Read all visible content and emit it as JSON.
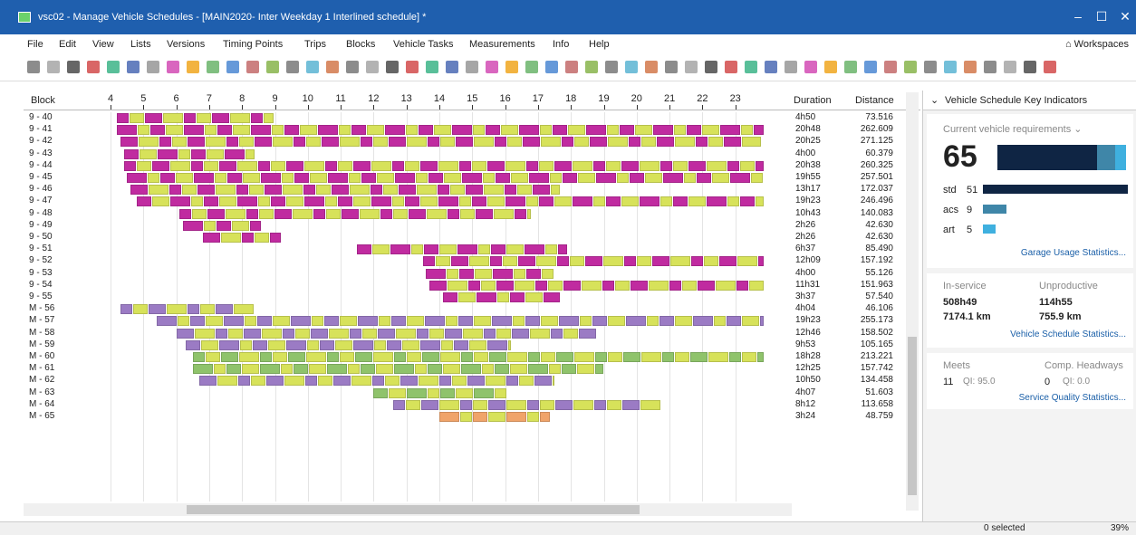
{
  "window": {
    "title": "vsc02 - Manage Vehicle Schedules - [MAIN2020- Inter Weekday 1 Interlined schedule] *"
  },
  "menu": [
    "File",
    "Edit",
    "View",
    "Lists",
    "Versions",
    "Timing Points",
    "Trips",
    "Blocks",
    "Vehicle Tasks",
    "Measurements",
    "Info",
    "Help"
  ],
  "workspaces_label": "Workspaces",
  "grid": {
    "block_header": "Block",
    "duration_header": "Duration",
    "distance_header": "Distance",
    "hours": [
      "4",
      "5",
      "6",
      "7",
      "8",
      "9",
      "10",
      "11",
      "12",
      "13",
      "14",
      "15",
      "16",
      "17",
      "18",
      "19",
      "20",
      "21",
      "22",
      "23"
    ],
    "rows": [
      {
        "block": "9 - 40",
        "duration": "4h50",
        "distance": "73.516",
        "start": 4.2,
        "end": 9.0,
        "color": "magenta"
      },
      {
        "block": "9 - 41",
        "duration": "20h48",
        "distance": "262.609",
        "start": 4.2,
        "end": 23.9,
        "color": "magenta"
      },
      {
        "block": "9 - 42",
        "duration": "20h25",
        "distance": "271.125",
        "start": 4.3,
        "end": 23.8,
        "color": "magenta"
      },
      {
        "block": "9 - 43",
        "duration": "4h00",
        "distance": "60.379",
        "start": 4.4,
        "end": 8.4,
        "color": "magenta"
      },
      {
        "block": "9 - 44",
        "duration": "20h38",
        "distance": "260.325",
        "start": 4.4,
        "end": 23.9,
        "color": "magenta"
      },
      {
        "block": "9 - 45",
        "duration": "19h55",
        "distance": "257.501",
        "start": 4.5,
        "end": 23.9,
        "color": "magenta"
      },
      {
        "block": "9 - 46",
        "duration": "13h17",
        "distance": "172.037",
        "start": 4.6,
        "end": 17.7,
        "color": "magenta"
      },
      {
        "block": "9 - 47",
        "duration": "19h23",
        "distance": "246.496",
        "start": 4.8,
        "end": 23.9,
        "color": "magenta"
      },
      {
        "block": "9 - 48",
        "duration": "10h43",
        "distance": "140.083",
        "start": 6.1,
        "end": 16.8,
        "color": "magenta"
      },
      {
        "block": "9 - 49",
        "duration": "2h26",
        "distance": "42.630",
        "start": 6.2,
        "end": 8.6,
        "color": "magenta"
      },
      {
        "block": "9 - 50",
        "duration": "2h26",
        "distance": "42.630",
        "start": 6.8,
        "end": 9.2,
        "color": "magenta"
      },
      {
        "block": "9 - 51",
        "duration": "6h37",
        "distance": "85.490",
        "start": 11.5,
        "end": 17.9,
        "color": "magenta"
      },
      {
        "block": "9 - 52",
        "duration": "12h09",
        "distance": "157.192",
        "start": 13.5,
        "end": 23.9,
        "color": "magenta"
      },
      {
        "block": "9 - 53",
        "duration": "4h00",
        "distance": "55.126",
        "start": 13.6,
        "end": 17.5,
        "color": "magenta"
      },
      {
        "block": "9 - 54",
        "duration": "11h31",
        "distance": "151.963",
        "start": 13.7,
        "end": 23.9,
        "color": "magenta"
      },
      {
        "block": "9 - 55",
        "duration": "3h37",
        "distance": "57.540",
        "start": 14.1,
        "end": 17.7,
        "color": "magenta"
      },
      {
        "block": "M - 56",
        "duration": "4h04",
        "distance": "46.106",
        "start": 4.3,
        "end": 8.4,
        "color": "purple"
      },
      {
        "block": "M - 57",
        "duration": "19h23",
        "distance": "255.173",
        "start": 5.4,
        "end": 23.9,
        "color": "purple"
      },
      {
        "block": "M - 58",
        "duration": "12h46",
        "distance": "158.502",
        "start": 6.0,
        "end": 18.8,
        "color": "purple"
      },
      {
        "block": "M - 59",
        "duration": "9h53",
        "distance": "105.165",
        "start": 6.3,
        "end": 16.2,
        "color": "purple"
      },
      {
        "block": "M - 60",
        "duration": "18h28",
        "distance": "213.221",
        "start": 6.5,
        "end": 23.9,
        "color": "green"
      },
      {
        "block": "M - 61",
        "duration": "12h25",
        "distance": "157.742",
        "start": 6.5,
        "end": 19.0,
        "color": "green"
      },
      {
        "block": "M - 62",
        "duration": "10h50",
        "distance": "134.458",
        "start": 6.7,
        "end": 17.5,
        "color": "purple"
      },
      {
        "block": "M - 63",
        "duration": "4h07",
        "distance": "51.603",
        "start": 12.0,
        "end": 16.1,
        "color": "green"
      },
      {
        "block": "M - 64",
        "duration": "8h12",
        "distance": "113.658",
        "start": 12.6,
        "end": 20.8,
        "color": "purple"
      },
      {
        "block": "M - 65",
        "duration": "3h24",
        "distance": "48.759",
        "start": 14.0,
        "end": 17.4,
        "color": "orange"
      }
    ]
  },
  "panel": {
    "title": "Vehicle Schedule Key Indicators",
    "current_req_label": "Current vehicle requirements",
    "total": "65",
    "std_label": "std",
    "std_value": "51",
    "acs_label": "acs",
    "acs_value": "9",
    "art_label": "art",
    "art_value": "5",
    "garage_link": "Garage Usage Statistics...",
    "inservice_label": "In-service",
    "inservice_time": "508h49",
    "inservice_km": "7174.1 km",
    "unproductive_label": "Unproductive",
    "unproductive_time": "114h55",
    "unproductive_km": "755.9 km",
    "vs_link": "Vehicle Schedule Statistics...",
    "meets_label": "Meets",
    "meets_value": "11",
    "meets_qi": "QI: 95.0",
    "comp_label": "Comp. Headways",
    "comp_value": "0",
    "comp_qi": "QI: 0.0",
    "sq_link": "Service Quality Statistics..."
  },
  "status": {
    "selected": "0 selected",
    "zoom": "39%"
  },
  "colors": {
    "magenta": "#c02ba0",
    "lime": "#d7e25a",
    "purple": "#9b7bc4",
    "green": "#8fc36b",
    "orange": "#f0a46a",
    "titlebar": "#1f5fae",
    "navy": "#0f2544",
    "teal": "#3f86a8",
    "skyblue": "#3fb0df"
  }
}
